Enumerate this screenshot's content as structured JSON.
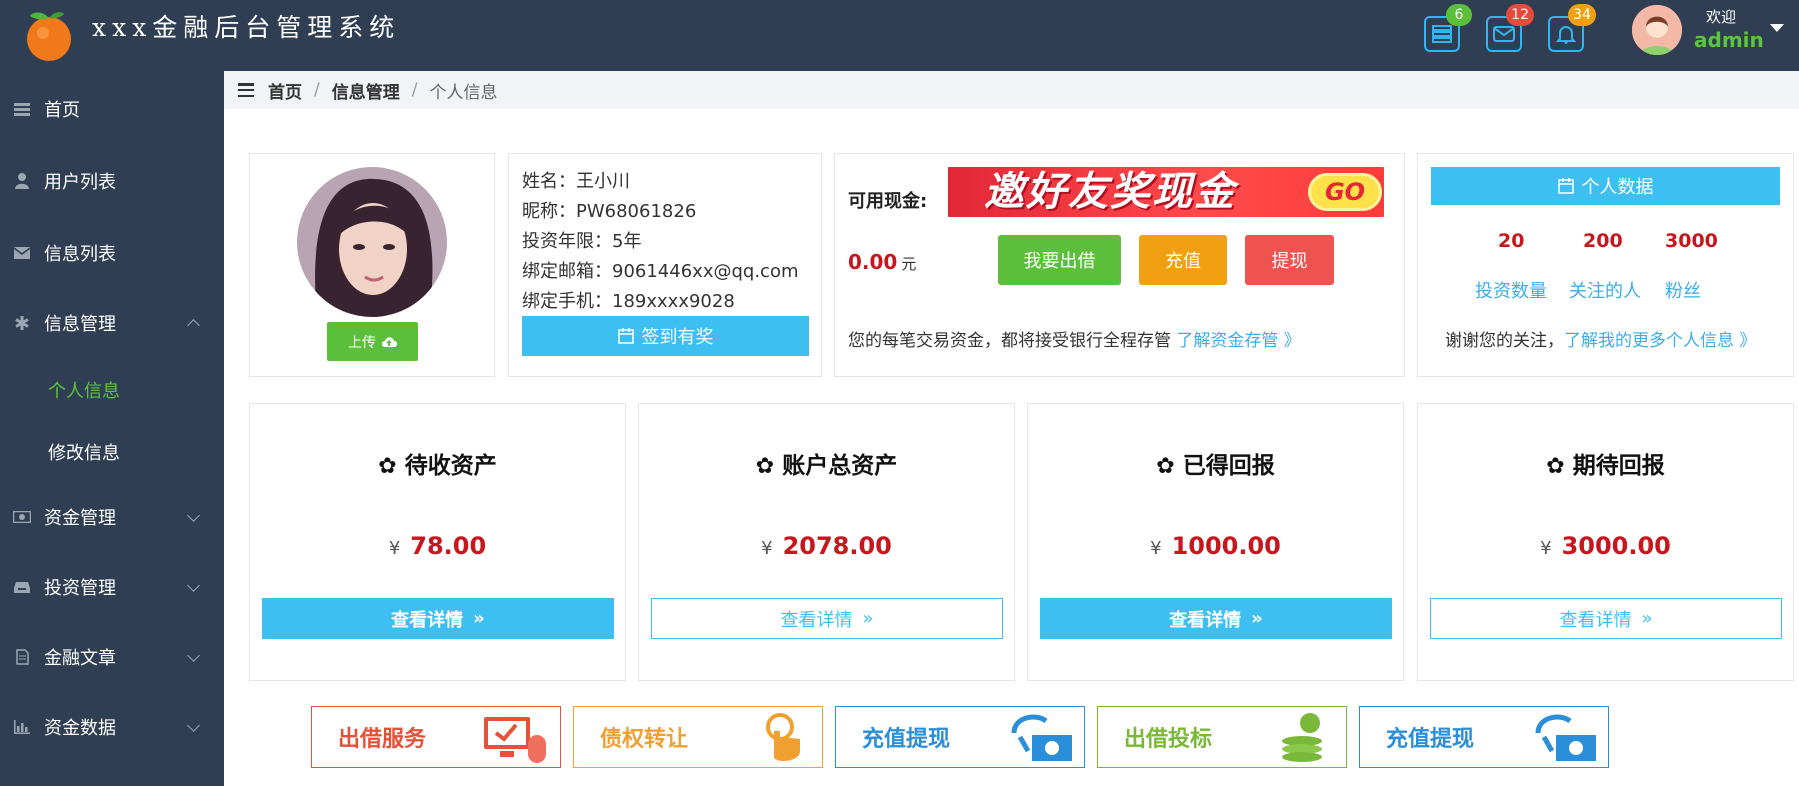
{
  "header": {
    "title": "xxx金融后台管理系统",
    "badges": {
      "tasks": "6",
      "messages": "12",
      "notifications": "34"
    },
    "welcome": "欢迎",
    "username": "admin"
  },
  "sidebar": {
    "items": [
      {
        "label": "首页"
      },
      {
        "label": "用户列表"
      },
      {
        "label": "信息列表"
      },
      {
        "label": "信息管理"
      },
      {
        "label": "资金管理"
      },
      {
        "label": "投资管理"
      },
      {
        "label": "金融文章"
      },
      {
        "label": "资金数据"
      }
    ],
    "subitems": [
      {
        "label": "个人信息"
      },
      {
        "label": "修改信息"
      }
    ]
  },
  "breadcrumb": {
    "home": "首页",
    "section": "信息管理",
    "current": "个人信息"
  },
  "profile": {
    "upload_label": "上传",
    "name": "姓名：王小川",
    "nickname": "昵称：PW68061826",
    "term": "投资年限：5年",
    "email": "绑定邮箱：9061446xx@qq.com",
    "phone": "绑定手机：189xxxx9028",
    "sign_label": "签到有奖"
  },
  "cash": {
    "label": "可用现金:",
    "banner_text": "邀好友奖现金",
    "banner_go": "GO",
    "amount": "0.00",
    "unit": "元",
    "buttons": {
      "lend": "我要出借",
      "recharge": "充值",
      "withdraw": "提现"
    },
    "note": "您的每笔交易资金，都将接受银行全程存管",
    "note_link": "了解资金存管 》"
  },
  "personal_data": {
    "title": "个人数据",
    "stats": [
      {
        "value": "20",
        "label": "投资数量"
      },
      {
        "value": "200",
        "label": "关注的人"
      },
      {
        "value": "3000",
        "label": "粉丝"
      }
    ],
    "thanks": "谢谢您的关注，",
    "thanks_link": "了解我的更多个人信息 》"
  },
  "assets": [
    {
      "title": "待收资产",
      "yen": "¥",
      "amount": "78.00",
      "button": "查看详情"
    },
    {
      "title": "账户总资产",
      "yen": "¥",
      "amount": "2078.00",
      "button": "查看详情"
    },
    {
      "title": "已得回报",
      "yen": "¥",
      "amount": "1000.00",
      "button": "查看详情"
    },
    {
      "title": "期待回报",
      "yen": "¥",
      "amount": "3000.00",
      "button": "查看详情"
    }
  ],
  "tiles": [
    {
      "label": "出借服务",
      "color": "#e8503a"
    },
    {
      "label": "债权转让",
      "color": "#f0a030"
    },
    {
      "label": "充值提现",
      "color": "#2a8fd8"
    },
    {
      "label": "出借投标",
      "color": "#7ab83a"
    },
    {
      "label": "充值提现",
      "color": "#2a8fd8"
    }
  ],
  "colors": {
    "nav_bg": "#2f3e52",
    "accent_blue": "#3dc0f1",
    "green": "#5bbf3c",
    "orange": "#f0a010",
    "red": "#ef5350",
    "amount_red": "#c8161d"
  }
}
